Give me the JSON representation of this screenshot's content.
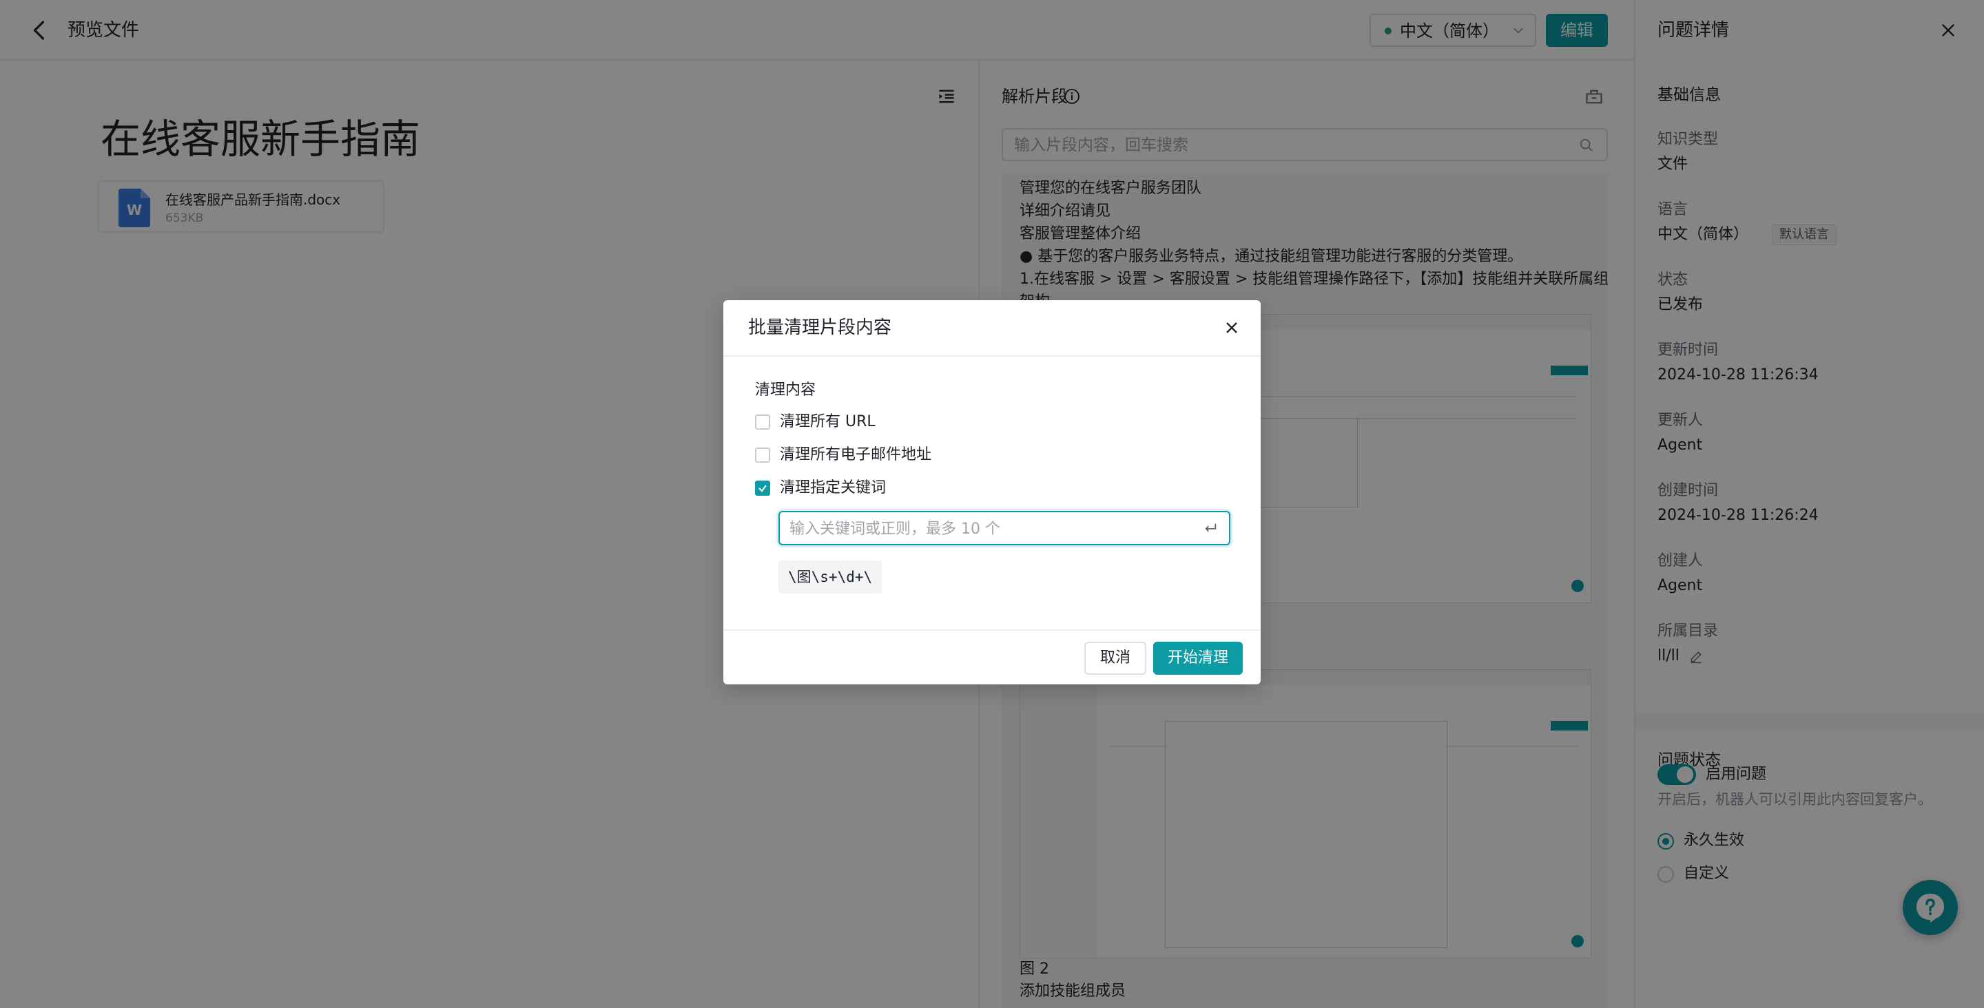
{
  "header": {
    "title": "预览文件",
    "language": "中文（简体）",
    "edit_label": "编辑"
  },
  "document": {
    "title": "在线客服新手指南",
    "file_name": "在线客服产品新手指南.docx",
    "file_size": "653KB",
    "file_badge": "W"
  },
  "parse_panel": {
    "title": "解析片段",
    "search_placeholder": "输入片段内容，回车搜索",
    "lines": [
      "管理您的在线客户服务团队",
      "详细介绍请见",
      "客服管理整体介绍",
      "● 基于您的客户服务业务特点，通过技能组管理功能进行客服的分类管理。",
      "1.在线客服 > 设置 > 客服设置 > 技能组管理操作路径下，【添加】技能组并关联所属组织",
      "架构"
    ],
    "figure_caption": "图 2",
    "after_caption": "添加技能组成员"
  },
  "details_panel": {
    "title": "问题详情",
    "basic_info": "基础信息",
    "fields": [
      {
        "label": "知识类型",
        "value": "文件"
      },
      {
        "label": "语言",
        "value": "中文（简体）",
        "tag": "默认语言"
      },
      {
        "label": "状态",
        "value": "已发布"
      },
      {
        "label": "更新时间",
        "value": "2024-10-28 11:26:34"
      },
      {
        "label": "更新人",
        "value": "Agent"
      },
      {
        "label": "创建时间",
        "value": "2024-10-28 11:26:24"
      },
      {
        "label": "创建人",
        "value": "Agent"
      },
      {
        "label": "所属目录",
        "value": "ll/ll"
      }
    ],
    "status_section": "问题状态",
    "enable_label": "启用问题",
    "enable_on": true,
    "enable_hint": "开启后，机器人可以引用此内容回复客户。",
    "validity_options": [
      "永久生效",
      "自定义"
    ],
    "validity_selected": 0
  },
  "dialog": {
    "title": "批量清理片段内容",
    "section_label": "清理内容",
    "options": [
      {
        "label": "清理所有 URL",
        "checked": false
      },
      {
        "label": "清理所有电子邮件地址",
        "checked": false
      },
      {
        "label": "清理指定关键词",
        "checked": true
      }
    ],
    "keyword_placeholder": "输入关键词或正则，最多 10 个",
    "keyword_tags": [
      "\\图\\s+\\d+\\"
    ],
    "cancel_label": "取消",
    "confirm_label": "开始清理"
  },
  "colors": {
    "accent": "#0d9ba5",
    "status_dot": "#2ba471",
    "overlay": "rgba(0,0,0,0.48)"
  },
  "icons": {
    "back": "chevron-left-icon",
    "outline": "outline-list-icon",
    "info": "info-icon",
    "parse_tool": "cleanup-tool-icon",
    "search": "search-icon",
    "close": "close-icon",
    "edit": "pencil-icon",
    "enter": "enter-key-icon",
    "help": "help-chat-icon"
  }
}
